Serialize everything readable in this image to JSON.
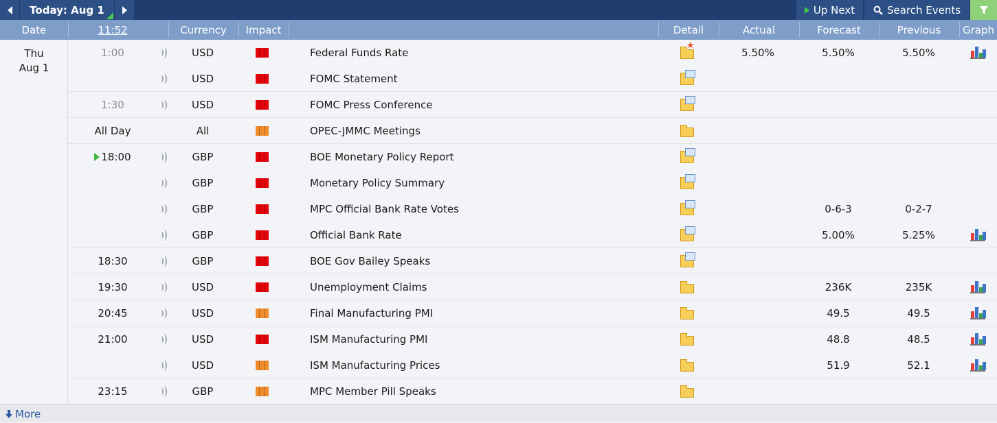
{
  "toolbar": {
    "today_label": "Today: Aug 1",
    "up_next_label": "Up Next",
    "search_label": "Search Events"
  },
  "header": {
    "date": "Date",
    "time": "11:52",
    "currency": "Currency",
    "impact": "Impact",
    "detail": "Detail",
    "actual": "Actual",
    "forecast": "Forecast",
    "previous": "Previous",
    "graph": "Graph"
  },
  "day": {
    "weekday": "Thu",
    "date": "Aug 1"
  },
  "colors": {
    "high_impact": "#e4050b",
    "medium_impact": "#f08c2c",
    "accent": "#1f3d6e"
  },
  "events": [
    {
      "time": "1:00",
      "currency": "USD",
      "impact": "high",
      "event": "Federal Funds Rate",
      "actual": "5.50%",
      "forecast": "5.50%",
      "previous": "5.50%"
    },
    {
      "time": "",
      "currency": "USD",
      "impact": "high",
      "event": "FOMC Statement",
      "actual": "",
      "forecast": "",
      "previous": ""
    },
    {
      "time": "1:30",
      "currency": "USD",
      "impact": "high",
      "event": "FOMC Press Conference",
      "actual": "",
      "forecast": "",
      "previous": ""
    },
    {
      "time": "All Day",
      "currency": "All",
      "impact": "medium",
      "event": "OPEC-JMMC Meetings",
      "actual": "",
      "forecast": "",
      "previous": ""
    },
    {
      "time": "18:00",
      "currency": "GBP",
      "impact": "high",
      "event": "BOE Monetary Policy Report",
      "actual": "",
      "forecast": "",
      "previous": ""
    },
    {
      "time": "",
      "currency": "GBP",
      "impact": "high",
      "event": "Monetary Policy Summary",
      "actual": "",
      "forecast": "",
      "previous": ""
    },
    {
      "time": "",
      "currency": "GBP",
      "impact": "high",
      "event": "MPC Official Bank Rate Votes",
      "actual": "",
      "forecast": "0-6-3",
      "previous": "0-2-7"
    },
    {
      "time": "",
      "currency": "GBP",
      "impact": "high",
      "event": "Official Bank Rate",
      "actual": "",
      "forecast": "5.00%",
      "previous": "5.25%"
    },
    {
      "time": "18:30",
      "currency": "GBP",
      "impact": "high",
      "event": "BOE Gov Bailey Speaks",
      "actual": "",
      "forecast": "",
      "previous": ""
    },
    {
      "time": "19:30",
      "currency": "USD",
      "impact": "high",
      "event": "Unemployment Claims",
      "actual": "",
      "forecast": "236K",
      "previous": "235K"
    },
    {
      "time": "20:45",
      "currency": "USD",
      "impact": "medium",
      "event": "Final Manufacturing PMI",
      "actual": "",
      "forecast": "49.5",
      "previous": "49.5"
    },
    {
      "time": "21:00",
      "currency": "USD",
      "impact": "high",
      "event": "ISM Manufacturing PMI",
      "actual": "",
      "forecast": "48.8",
      "previous": "48.5"
    },
    {
      "time": "",
      "currency": "USD",
      "impact": "medium",
      "event": "ISM Manufacturing Prices",
      "actual": "",
      "forecast": "51.9",
      "previous": "52.1"
    },
    {
      "time": "23:15",
      "currency": "GBP",
      "impact": "medium",
      "event": "MPC Member Pill Speaks",
      "actual": "",
      "forecast": "",
      "previous": ""
    }
  ],
  "footer": {
    "more_label": "More"
  }
}
